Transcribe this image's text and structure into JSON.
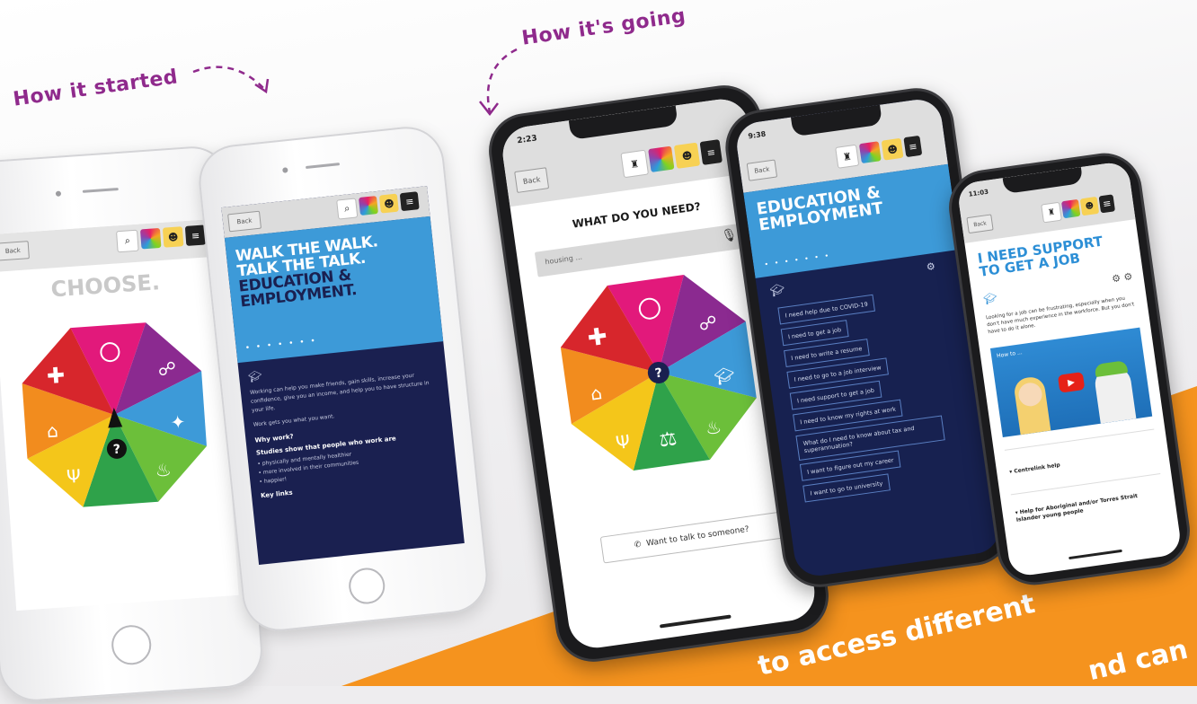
{
  "captions": {
    "started": "How it started",
    "going": "How it's going"
  },
  "bottom_text": {
    "line1": "to access different",
    "line2": "nd can"
  },
  "colors": {
    "accent": "#8f2a8c",
    "orange": "#f5931e",
    "blue": "#3d9ad8",
    "navy": "#1a2050"
  },
  "phone1": {
    "back": "Back",
    "title": "CHOOSE.",
    "question": "?"
  },
  "phone2": {
    "back": "Back",
    "headline1": "WALK THE WALK.",
    "headline2": "TALK THE TALK.",
    "headline3": "EDUCATION &",
    "headline4": "EMPLOYMENT.",
    "body1": "Working can help you make friends, gain skills, increase your confidence, give you an income, and help you to have structure in your life.",
    "body2": "Work gets you what you want.",
    "why_heading": "Why work?",
    "studies": "Studies show that people who work are",
    "bullets": [
      "physically and mentally healthier",
      "more involved in their communities",
      "happier!"
    ],
    "key_links": "Key links"
  },
  "phone3": {
    "time": "2:23",
    "back": "Back",
    "title": "WHAT DO YOU NEED?",
    "search_value": "housing ...",
    "question": "?",
    "talk_button": "Want to talk to someone?"
  },
  "phone4": {
    "time": "9:38",
    "back": "Back",
    "title1": "EDUCATION &",
    "title2": "EMPLOYMENT",
    "options": [
      "I need help due to COVID-19",
      "I need to get a job",
      "I need to write a resume",
      "I need to go to a job interview",
      "I need support to get a job",
      "I need to know my rights at work",
      "What do I need to know about tax and superannuation?",
      "I want to figure out my career",
      "I want to go to university"
    ]
  },
  "phone5": {
    "time": "11:03",
    "back": "Back",
    "title1": "I NEED SUPPORT",
    "title2": "TO GET A JOB",
    "body": "Looking for a job can be frustrating, especially when you don't have much experience in the workforce. But you don't have to do it alone.",
    "video_title": "How to ...",
    "link1": "Centrelink help",
    "link2": "Help for Aboriginal and/or Torres Strait Islander young people"
  }
}
